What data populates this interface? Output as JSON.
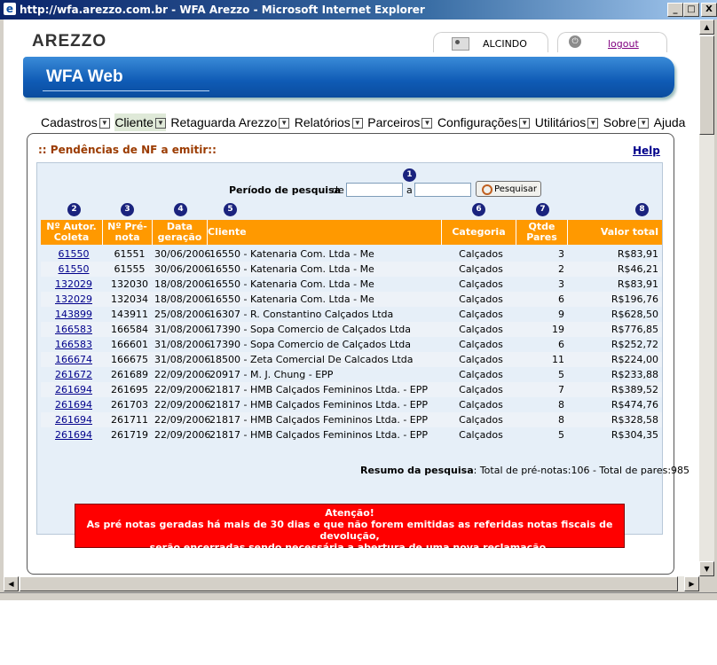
{
  "window": {
    "title": "http://wfa.arezzo.com.br - WFA Arezzo - Microsoft Internet Explorer",
    "btn_min": "_",
    "btn_max": "□",
    "btn_close": "X"
  },
  "header": {
    "logo": "AREZZO",
    "user": "ALCINDO",
    "logout": "logout",
    "banner_title": "WFA Web"
  },
  "menu": [
    "Cadastros",
    "Cliente",
    "Retaguarda Arezzo",
    "Relatórios",
    "Parceiros",
    "Configurações",
    "Utilitários",
    "Sobre",
    "Ajuda"
  ],
  "panel": {
    "title": ":: Pendências de NF a emitir::",
    "help": "Help"
  },
  "search": {
    "period_label": "Período de pesquisa",
    "from_label": "de",
    "to_label": "a",
    "button": "Pesquisar"
  },
  "markers": [
    "1",
    "2",
    "3",
    "4",
    "5",
    "6",
    "7",
    "8"
  ],
  "columns": {
    "autor": "Nº Autor.\nColeta",
    "prenota": "Nº Pré-\nnota",
    "data": "Data\ngeração",
    "cliente": "Cliente",
    "categoria": "Categoria",
    "qtde": "Qtde\nPares",
    "valor": "Valor total"
  },
  "rows": [
    {
      "autor": "61550",
      "prenota": "61551",
      "data": "30/06/2006",
      "cliente": "16550 - Katenaria Com. Ltda - Me",
      "categoria": "Calçados",
      "qtde": "3",
      "valor": "R$83,91"
    },
    {
      "autor": "61550",
      "prenota": "61555",
      "data": "30/06/2006",
      "cliente": "16550 - Katenaria Com. Ltda - Me",
      "categoria": "Calçados",
      "qtde": "2",
      "valor": "R$46,21"
    },
    {
      "autor": "132029",
      "prenota": "132030",
      "data": "18/08/2006",
      "cliente": "16550 - Katenaria Com. Ltda - Me",
      "categoria": "Calçados",
      "qtde": "3",
      "valor": "R$83,91"
    },
    {
      "autor": "132029",
      "prenota": "132034",
      "data": "18/08/2006",
      "cliente": "16550 - Katenaria Com. Ltda - Me",
      "categoria": "Calçados",
      "qtde": "6",
      "valor": "R$196,76"
    },
    {
      "autor": "143899",
      "prenota": "143911",
      "data": "25/08/2006",
      "cliente": "16307 - R. Constantino Calçados Ltda",
      "categoria": "Calçados",
      "qtde": "9",
      "valor": "R$628,50"
    },
    {
      "autor": "166583",
      "prenota": "166584",
      "data": "31/08/2006",
      "cliente": "17390 - Sopa Comercio de Calçados Ltda",
      "categoria": "Calçados",
      "qtde": "19",
      "valor": "R$776,85"
    },
    {
      "autor": "166583",
      "prenota": "166601",
      "data": "31/08/2006",
      "cliente": "17390 - Sopa Comercio de Calçados Ltda",
      "categoria": "Calçados",
      "qtde": "6",
      "valor": "R$252,72"
    },
    {
      "autor": "166674",
      "prenota": "166675",
      "data": "31/08/2006",
      "cliente": "18500 - Zeta Comercial De Calcados Ltda",
      "categoria": "Calçados",
      "qtde": "11",
      "valor": "R$224,00"
    },
    {
      "autor": "261672",
      "prenota": "261689",
      "data": "22/09/2006",
      "cliente": "20917 - M. J. Chung - EPP",
      "categoria": "Calçados",
      "qtde": "5",
      "valor": "R$233,88"
    },
    {
      "autor": "261694",
      "prenota": "261695",
      "data": "22/09/2006",
      "cliente": "21817 - HMB Calçados Femininos Ltda. - EPP",
      "categoria": "Calçados",
      "qtde": "7",
      "valor": "R$389,52"
    },
    {
      "autor": "261694",
      "prenota": "261703",
      "data": "22/09/2006",
      "cliente": "21817 - HMB Calçados Femininos Ltda. - EPP",
      "categoria": "Calçados",
      "qtde": "8",
      "valor": "R$474,76"
    },
    {
      "autor": "261694",
      "prenota": "261711",
      "data": "22/09/2006",
      "cliente": "21817 - HMB Calçados Femininos Ltda. - EPP",
      "categoria": "Calçados",
      "qtde": "8",
      "valor": "R$328,58"
    },
    {
      "autor": "261694",
      "prenota": "261719",
      "data": "22/09/2006",
      "cliente": "21817 - HMB Calçados Femininos Ltda. - EPP",
      "categoria": "Calçados",
      "qtde": "5",
      "valor": "R$304,35"
    }
  ],
  "summary": {
    "label": "Resumo da pesquisa",
    "text": ": Total de pré-notas:106 - Total de pares:985"
  },
  "alert": {
    "title": "Atenção!",
    "line1": "As pré notas geradas há mais de 30 dias e que não forem emitidas as referidas notas fiscais de devolução,",
    "line2": "serão encerradas sendo necessária a abertura de uma nova reclamação."
  },
  "colors": {
    "header_orange": "#ff9900",
    "alert_red": "#ff0000",
    "banner_blue": "#0f5bb5",
    "title_brown": "#9b3b00"
  }
}
